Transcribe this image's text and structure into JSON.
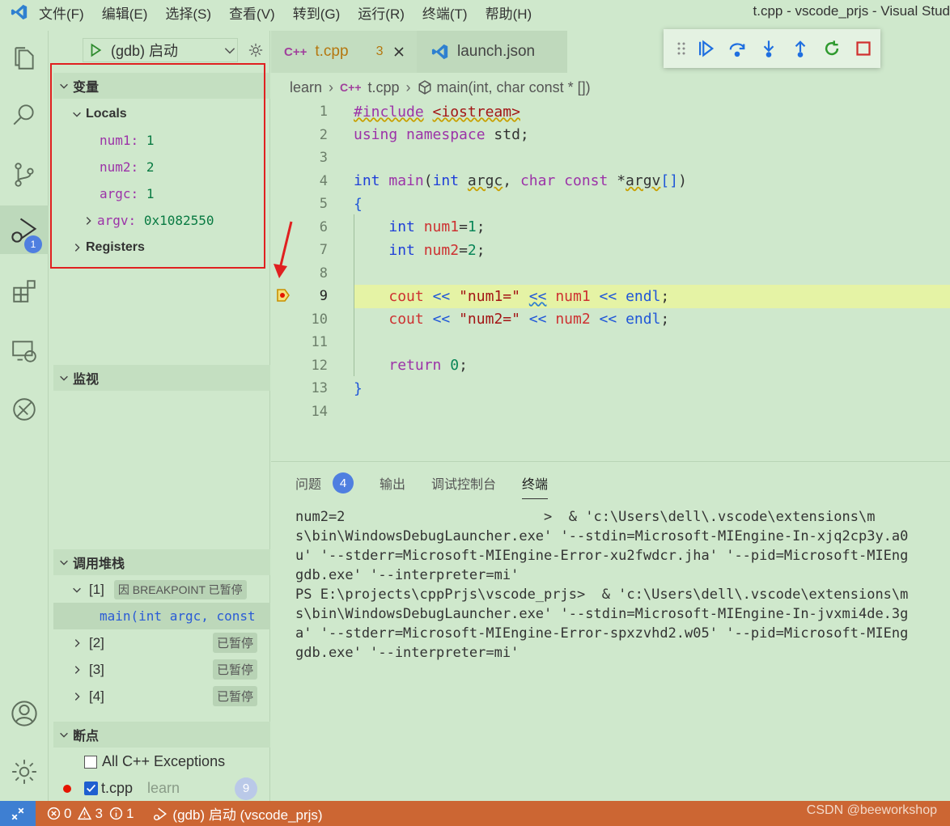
{
  "titlebar": {
    "menu": [
      "文件(F)",
      "编辑(E)",
      "选择(S)",
      "查看(V)",
      "转到(G)",
      "运行(R)",
      "终端(T)",
      "帮助(H)"
    ],
    "window_title": "t.cpp - vscode_prjs - Visual Stud"
  },
  "activity": {
    "debug_badge": "1"
  },
  "debug": {
    "config_label": "(gdb) 启动"
  },
  "variables": {
    "header": "变量",
    "locals_label": "Locals",
    "items": [
      {
        "name": "num1:",
        "value": "1"
      },
      {
        "name": "num2:",
        "value": "2"
      },
      {
        "name": "argc:",
        "value": "1"
      },
      {
        "name": "argv:",
        "value": "0x1082550"
      }
    ],
    "registers_label": "Registers"
  },
  "watch": {
    "header": "监视"
  },
  "callstack": {
    "header": "调用堆栈",
    "threads": [
      {
        "id": "[1]",
        "status": "因 BREAKPOINT 已暂停"
      },
      {
        "id": "[2]",
        "status": "已暂停"
      },
      {
        "id": "[3]",
        "status": "已暂停"
      },
      {
        "id": "[4]",
        "status": "已暂停"
      }
    ],
    "frame": "main(int argc, const"
  },
  "breakpoints": {
    "header": "断点",
    "exceptions_label": "All C++ Exceptions",
    "file": "t.cpp",
    "folder": "learn",
    "line_badge": "9"
  },
  "tabs": [
    {
      "label": "t.cpp",
      "problems": "3"
    },
    {
      "label": "launch.json"
    }
  ],
  "breadcrumb": {
    "folder": "learn",
    "file": "t.cpp",
    "symbol": "main(int, char const * [])"
  },
  "editor": {
    "current_line": 9,
    "line_numbers": [
      "1",
      "2",
      "3",
      "4",
      "5",
      "6",
      "7",
      "8",
      "9",
      "10",
      "11",
      "12",
      "13",
      "14"
    ]
  },
  "panel": {
    "tabs": [
      "问题",
      "输出",
      "调试控制台",
      "终端"
    ],
    "problems_count": "4",
    "terminal_lines": [
      "num2=2                        >  & 'c:\\Users\\dell\\.vscode\\extensions\\m",
      "s\\bin\\WindowsDebugLauncher.exe' '--stdin=Microsoft-MIEngine-In-xjq2cp3y.a0",
      "u' '--stderr=Microsoft-MIEngine-Error-xu2fwdcr.jha' '--pid=Microsoft-MIEng",
      "gdb.exe' '--interpreter=mi'",
      "PS E:\\projects\\cppPrjs\\vscode_prjs>  & 'c:\\Users\\dell\\.vscode\\extensions\\m",
      "s\\bin\\WindowsDebugLauncher.exe' '--stdin=Microsoft-MIEngine-In-jvxmi4de.3g",
      "a' '--stderr=Microsoft-MIEngine-Error-spxzvhd2.w05' '--pid=Microsoft-MIEng",
      "gdb.exe' '--interpreter=mi'"
    ]
  },
  "statusbar": {
    "errors": "0",
    "warnings": "3",
    "infos": "1",
    "debug_session": "(gdb) 启动 (vscode_prjs)",
    "watermark": "CSDN @beeworkshop"
  },
  "colors": {
    "statusbar": "#cc6633",
    "accent": "#4f7fe0",
    "highlight": "#e5f3a5"
  }
}
